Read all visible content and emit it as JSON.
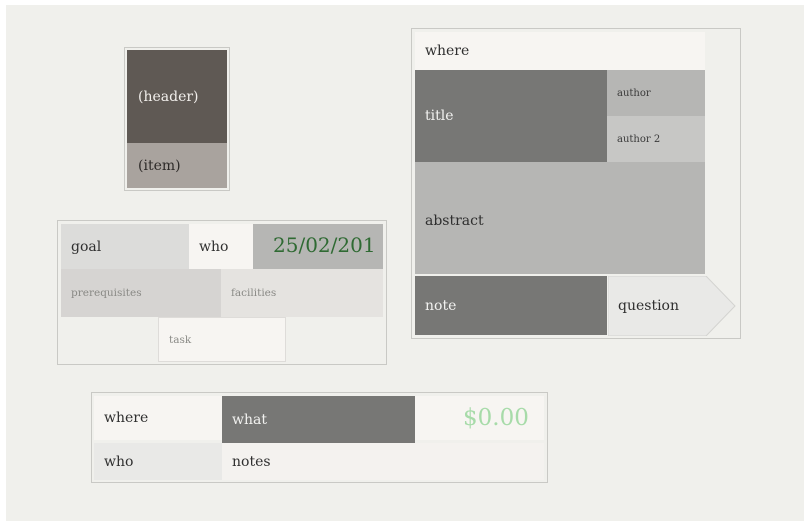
{
  "card_legend": {
    "header": "(header)",
    "item": "(item)"
  },
  "task_card": {
    "goal": "goal",
    "who": "who",
    "date": "25/02/201",
    "prerequisites": "prerequisites",
    "facilities": "facilities",
    "task": "task"
  },
  "paper_card": {
    "where": "where",
    "title": "title",
    "author": "author",
    "author2": "author 2",
    "abstract": "abstract",
    "note": "note",
    "question": "question"
  },
  "expense_card": {
    "where": "where",
    "what": "what",
    "amount": "$0.00",
    "who": "who",
    "notes": "notes"
  },
  "colors": {
    "background": "#f0f0ec",
    "dark_header": "#5f5954",
    "item_grey": "#a9a39e",
    "mid_grey": "#777775",
    "light_grey": "#b6b6b4",
    "date_green": "#2f6a33",
    "amount_green": "#a7dba9"
  }
}
